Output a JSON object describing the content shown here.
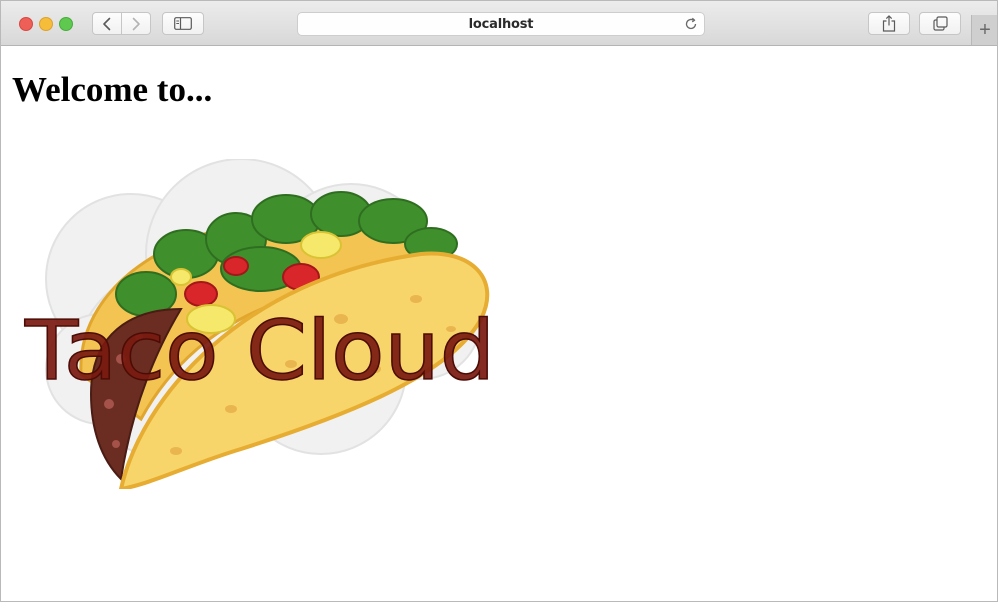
{
  "browser": {
    "address": "localhost",
    "new_tab_symbol": "+",
    "icons": {
      "back": "chevron-left-icon",
      "forward": "chevron-right-icon",
      "sidebar": "sidebar-icon",
      "reload": "reload-icon",
      "share": "share-icon",
      "tabs": "tabs-overview-icon"
    },
    "colors": {
      "close": "#ee5f57",
      "minimize": "#f6bd3b",
      "zoom": "#5ec84f"
    }
  },
  "page": {
    "heading": "Welcome to...",
    "logo_text": "Taco Cloud",
    "logo_colors": {
      "text": "#7a1a10",
      "shell": "#f7d56a",
      "meat": "#6b2d22",
      "lettuce": "#3b8a2a",
      "tomato": "#d9262a",
      "cheese": "#f6e86a"
    }
  }
}
